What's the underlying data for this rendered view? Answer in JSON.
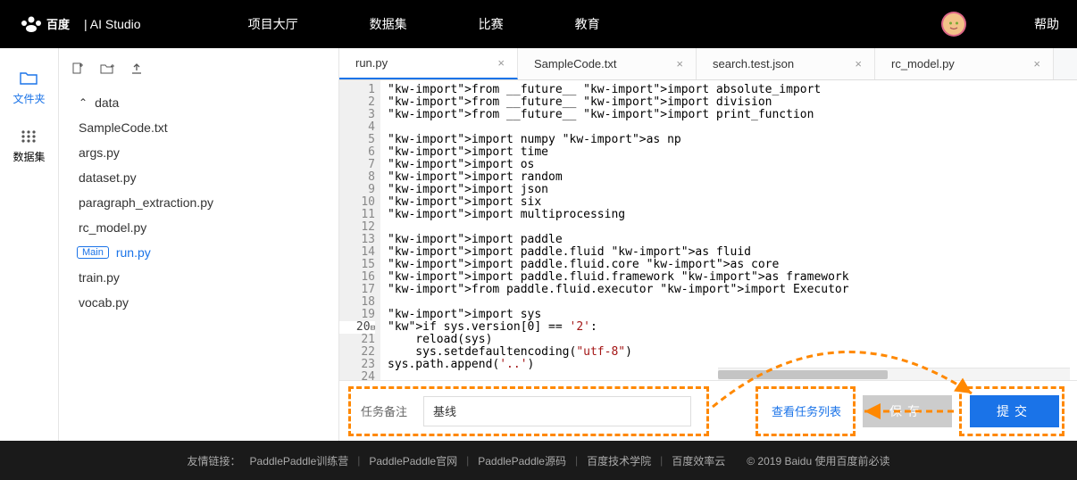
{
  "header": {
    "brand_suffix": "| AI Studio",
    "nav": [
      "项目大厅",
      "数据集",
      "比赛",
      "教育"
    ],
    "help": "帮助"
  },
  "rail": {
    "files": "文件夹",
    "datasets": "数据集"
  },
  "tree": {
    "folder": "data",
    "items": [
      "SampleCode.txt",
      "args.py",
      "dataset.py",
      "paragraph_extraction.py",
      "rc_model.py"
    ],
    "main_badge": "Main",
    "main_file": "run.py",
    "items2": [
      "train.py",
      "vocab.py"
    ]
  },
  "tabs": [
    {
      "label": "run.py",
      "active": true
    },
    {
      "label": "SampleCode.txt",
      "active": false
    },
    {
      "label": "search.test.json",
      "active": false
    },
    {
      "label": "rc_model.py",
      "active": false
    }
  ],
  "code_lines": [
    "from __future__ import absolute_import",
    "from __future__ import division",
    "from __future__ import print_function",
    "",
    "import numpy as np",
    "import time",
    "import os",
    "import random",
    "import json",
    "import six",
    "import multiprocessing",
    "",
    "import paddle",
    "import paddle.fluid as fluid",
    "import paddle.fluid.core as core",
    "import paddle.fluid.framework as framework",
    "from paddle.fluid.executor import Executor",
    "",
    "import sys",
    "if sys.version[0] == '2':",
    "    reload(sys)",
    "    sys.setdefaultencoding(\"utf-8\")",
    "sys.path.append('..')",
    ""
  ],
  "task": {
    "label": "任务备注",
    "value": "基线",
    "view_link": "查看任务列表",
    "save_btn": "保存",
    "submit_btn": "提交"
  },
  "footer": {
    "prefix": "友情链接：",
    "links": [
      "PaddlePaddle训练营",
      "PaddlePaddle官网",
      "PaddlePaddle源码",
      "百度技术学院",
      "百度效率云"
    ],
    "copyright": "© 2019 Baidu 使用百度前必读"
  }
}
